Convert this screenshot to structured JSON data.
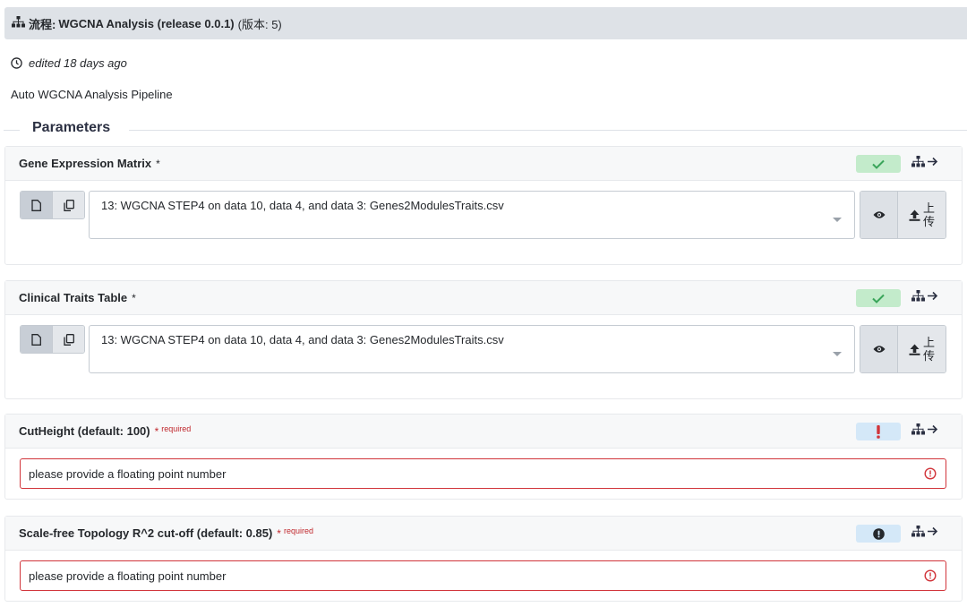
{
  "header": {
    "prefix": "流程:",
    "workflow_name": "WGCNA Analysis (release 0.0.1)",
    "version": "(版本: 5)"
  },
  "edited": "edited 18 days ago",
  "description": "Auto WGCNA Analysis Pipeline",
  "parameters_title": "Parameters",
  "cards": [
    {
      "label": "Gene Expression Matrix",
      "star": "*",
      "selected_dataset": "13: WGCNA STEP4 on data 10, data 4, and data 3: Genes2ModulesTraits.csv",
      "upload_label_1": "上",
      "upload_label_2": "传"
    },
    {
      "label": "Clinical Traits Table",
      "star": "*",
      "selected_dataset": "13: WGCNA STEP4 on data 10, data 4, and data 3: Genes2ModulesTraits.csv",
      "upload_label_1": "上",
      "upload_label_2": "传"
    },
    {
      "label": "CutHeight (default: 100)",
      "star": "*",
      "required": "required",
      "placeholder": "please provide a floating point number"
    },
    {
      "label": "Scale-free Topology R^2 cut-off (default: 0.85)",
      "star": "*",
      "required": "required",
      "placeholder": "please provide a floating point number"
    }
  ],
  "colors": {
    "header_bg": "#dee2e7",
    "ok_badge": "#c3ebcb",
    "ok_check": "#3aa55a",
    "err_badge": "#d4e8f8",
    "err_red": "#d1343a",
    "dark": "#25282c"
  }
}
